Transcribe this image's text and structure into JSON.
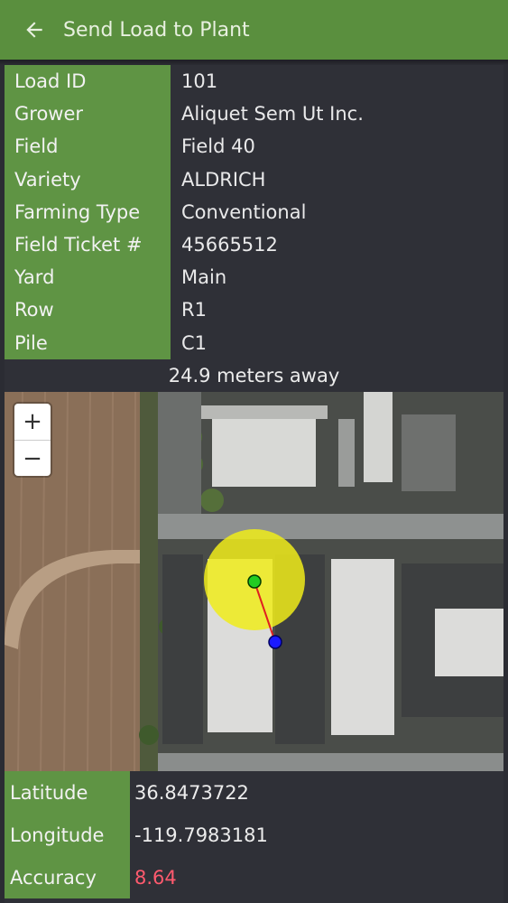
{
  "header": {
    "title": "Send Load to Plant",
    "back_icon": "arrow-left-icon"
  },
  "details": [
    {
      "label": "Load ID",
      "value": "101"
    },
    {
      "label": "Grower",
      "value": "Aliquet Sem Ut Inc."
    },
    {
      "label": "Field",
      "value": "Field 40"
    },
    {
      "label": "Variety",
      "value": "ALDRICH"
    },
    {
      "label": "Farming Type",
      "value": "Conventional"
    },
    {
      "label": "Field Ticket #",
      "value": "45665512"
    },
    {
      "label": "Yard",
      "value": "Main"
    },
    {
      "label": "Row",
      "value": "R1"
    },
    {
      "label": "Pile",
      "value": "C1"
    }
  ],
  "distance_text": "24.9 meters away",
  "map": {
    "zoom_in": "+",
    "zoom_out": "−"
  },
  "location": {
    "latitude_label": "Latitude",
    "latitude": "36.8473722",
    "longitude_label": "Longitude",
    "longitude": "-119.7983181",
    "accuracy_label": "Accuracy",
    "accuracy": "8.64"
  },
  "colors": {
    "header": "#5a8f3e",
    "label_bg": "#5f9444",
    "accuracy": "#ff5a6e",
    "target": "#22cc22",
    "current": "#1a1aff"
  }
}
